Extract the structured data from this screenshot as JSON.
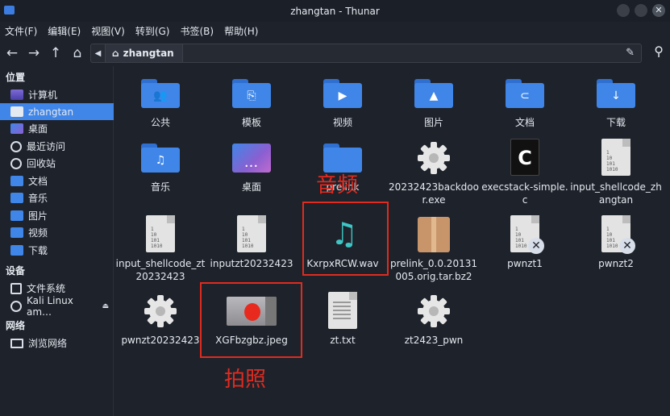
{
  "window": {
    "title": "zhangtan - Thunar",
    "close_glyph": "✕"
  },
  "menubar": [
    "文件(F)",
    "编辑(E)",
    "视图(V)",
    "转到(G)",
    "书签(B)",
    "帮助(H)"
  ],
  "toolbar": {
    "back_icon": "back-arrow-icon",
    "forward_icon": "forward-arrow-icon",
    "up_icon": "up-arrow-icon",
    "home_icon": "home-icon",
    "path": "zhangtan",
    "edit_icon": "pencil-icon",
    "search_icon": "search-icon"
  },
  "sidebar": {
    "places_heading": "位置",
    "places": [
      "计算机",
      "zhangtan",
      "桌面",
      "最近访问",
      "回收站",
      "文档",
      "音乐",
      "图片",
      "视频",
      "下载"
    ],
    "devices_heading": "设备",
    "devices": [
      "文件系统",
      "Kali Linux am…"
    ],
    "network_heading": "网络",
    "network": [
      "浏览网络"
    ]
  },
  "files": [
    {
      "label": "公共",
      "kind": "folder",
      "glyph": "👥"
    },
    {
      "label": "模板",
      "kind": "folder",
      "glyph": "⎘"
    },
    {
      "label": "视频",
      "kind": "folder",
      "glyph": "▶"
    },
    {
      "label": "图片",
      "kind": "folder",
      "glyph": "▲"
    },
    {
      "label": "文档",
      "kind": "folder",
      "glyph": "⊂"
    },
    {
      "label": "下载",
      "kind": "folder",
      "glyph": "↓"
    },
    {
      "label": "音乐",
      "kind": "folder",
      "glyph": "♫"
    },
    {
      "label": "桌面",
      "kind": "desktop",
      "glyph": "•••"
    },
    {
      "label": "prelink",
      "kind": "folder",
      "glyph": ""
    },
    {
      "label": "20232423backdoor.exe",
      "kind": "gear",
      "glyph": ""
    },
    {
      "label": "execstack-simple.c",
      "kind": "c",
      "glyph": "C"
    },
    {
      "label": "input_shellcode_zhangtan",
      "kind": "binary",
      "glyph": ""
    },
    {
      "label": "input_shellcode_zt20232423",
      "kind": "binary",
      "glyph": ""
    },
    {
      "label": "inputzt20232423",
      "kind": "binary",
      "glyph": ""
    },
    {
      "label": "KxrpxRCW.wav",
      "kind": "music",
      "glyph": "♫"
    },
    {
      "label": "prelink_0.0.20131005.orig.tar.bz2",
      "kind": "archive",
      "glyph": ""
    },
    {
      "label": "pwnzt1",
      "kind": "binary-x",
      "glyph": "✕"
    },
    {
      "label": "pwnzt2",
      "kind": "binary-x",
      "glyph": "✕"
    },
    {
      "label": "pwnzt20232423",
      "kind": "gear",
      "glyph": ""
    },
    {
      "label": "XGFbzgbz.jpeg",
      "kind": "photo",
      "glyph": ""
    },
    {
      "label": "zt.txt",
      "kind": "text",
      "glyph": ""
    },
    {
      "label": "zt2423_pwn",
      "kind": "gear",
      "glyph": ""
    }
  ],
  "binary_text": "1\n10\n101\n1010",
  "annotations": {
    "audio_label": "音频",
    "photo_label": "拍照",
    "color": "#e02b20"
  },
  "colors": {
    "accent": "#3f86e8",
    "background": "#1e222a"
  }
}
